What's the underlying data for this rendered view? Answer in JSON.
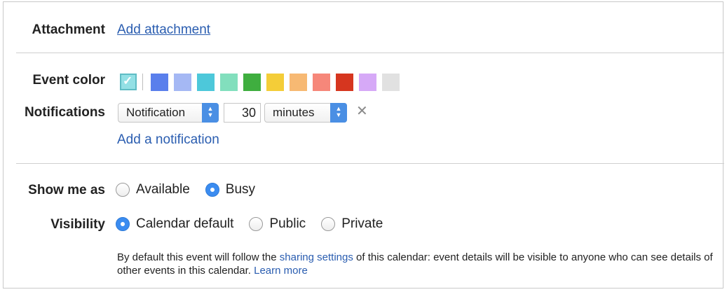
{
  "attachment": {
    "label": "Attachment",
    "add_link": "Add attachment"
  },
  "event_color": {
    "label": "Event color",
    "default_selected": true,
    "swatches": [
      "#5a7fec",
      "#a5b8f4",
      "#4dc8da",
      "#82dfbd",
      "#3fae3f",
      "#f4cd38",
      "#f7b973",
      "#f6877a",
      "#d6361f",
      "#d6a9f7",
      "#e1e1e1"
    ]
  },
  "notifications": {
    "label": "Notifications",
    "type_value": "Notification",
    "amount_value": "30",
    "unit_value": "minutes",
    "add_link": "Add a notification"
  },
  "show_me_as": {
    "label": "Show me as",
    "options": [
      "Available",
      "Busy"
    ],
    "selected": "Busy"
  },
  "visibility": {
    "label": "Visibility",
    "options": [
      "Calendar default",
      "Public",
      "Private"
    ],
    "selected": "Calendar default",
    "info_prefix": "By default this event will follow the ",
    "info_link": "sharing settings",
    "info_suffix": " of this calendar: event details will be visible to anyone who can see details of other events in this calendar.  ",
    "learn_more": "Learn more"
  },
  "colors": {
    "link": "#2a5db0",
    "accent": "#3b8cf0"
  }
}
